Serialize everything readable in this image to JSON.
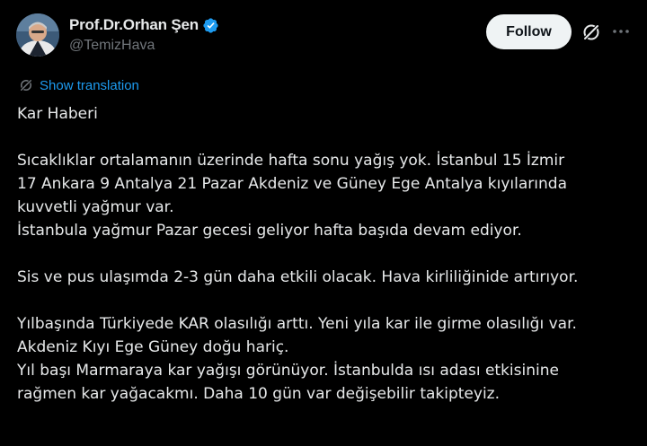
{
  "author": {
    "display_name": "Prof.Dr.Orhan Şen",
    "handle": "@TemizHava",
    "verified": true
  },
  "actions": {
    "follow_label": "Follow",
    "grok_icon": "grok-icon",
    "more_icon": "more-icon"
  },
  "translation": {
    "label": "Show translation"
  },
  "tweet": {
    "lines": [
      "Kar Haberi",
      "",
      "Sıcaklıklar ortalamanın üzerinde hafta sonu yağış yok. İstanbul 15 İzmir",
      "17 Ankara 9 Antalya 21 Pazar Akdeniz ve Güney Ege Antalya kıyılarında",
      "kuvvetli yağmur var.",
      "İstanbula yağmur Pazar gecesi geliyor hafta başıda devam ediyor.",
      "",
      "Sis ve pus ulaşımda 2-3 gün daha etkili olacak. Hava kirliliğinide artırıyor.",
      "",
      "Yılbaşında Türkiyede KAR olasılığı arttı. Yeni yıla kar ile girme olasılığı var.",
      "Akdeniz Kıyı Ege Güney doğu hariç.",
      "Yıl başı Marmaraya kar yağışı görünüyor. İstanbulda ısı adası etkisinine",
      "rağmen kar yağacakmı. Daha 10 gün var değişebilir takipteyiz."
    ]
  },
  "colors": {
    "background": "#000000",
    "text": "#e7e9ea",
    "secondary": "#71767b",
    "link": "#1d9bf0",
    "follow_bg": "#eff3f4"
  }
}
